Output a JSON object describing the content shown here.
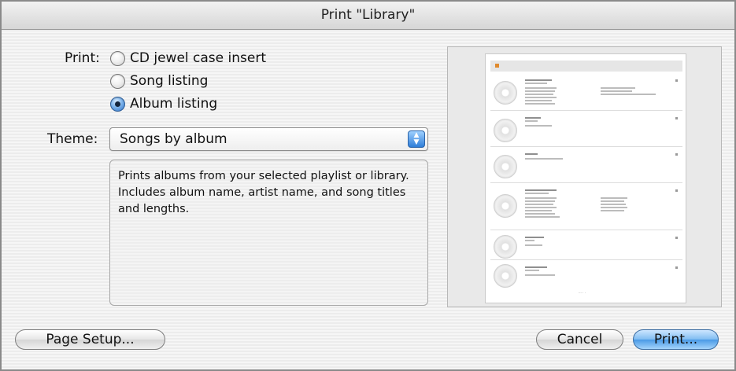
{
  "window": {
    "title": "Print \"Library\""
  },
  "print_section": {
    "label": "Print:",
    "options": [
      {
        "label": "CD jewel case insert",
        "selected": false
      },
      {
        "label": "Song listing",
        "selected": false
      },
      {
        "label": "Album listing",
        "selected": true
      }
    ]
  },
  "theme": {
    "label": "Theme:",
    "value": "Songs by album"
  },
  "description": "Prints albums from your selected playlist or library. Includes album name, artist name, and song titles and lengths.",
  "buttons": {
    "page_setup": "Page Setup...",
    "cancel": "Cancel",
    "print": "Print..."
  },
  "icons": {
    "popup_arrows": "up-down-arrows-icon",
    "album_art": "cd-disc-icon"
  },
  "colors": {
    "accent": "#3a8fe0",
    "window_bg": "#ececec"
  }
}
